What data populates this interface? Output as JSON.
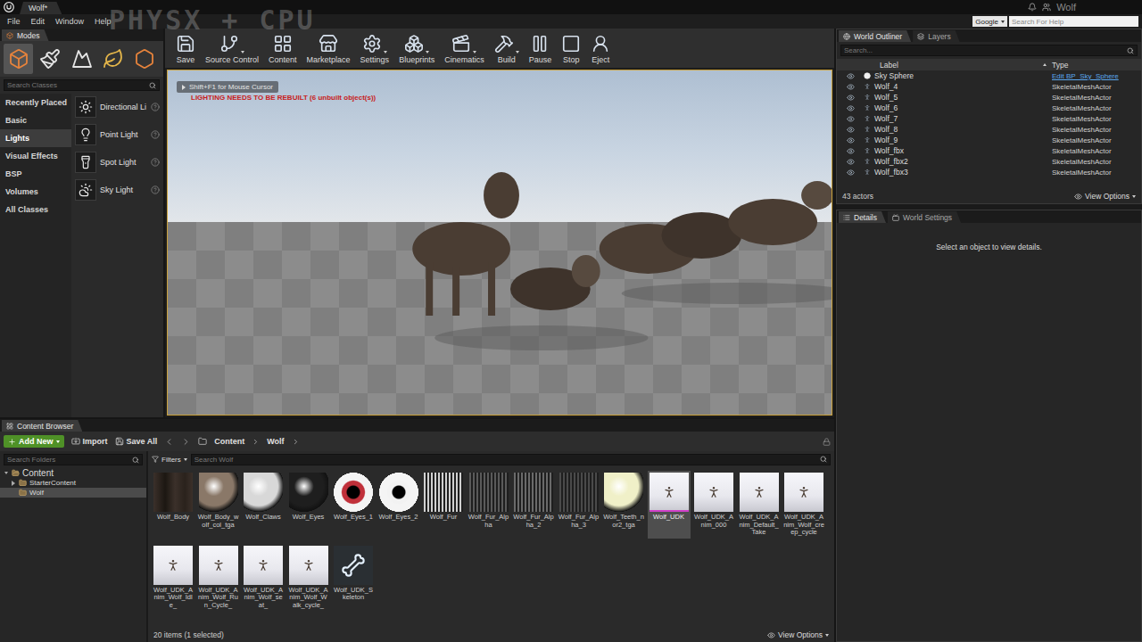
{
  "window": {
    "tab": "Wolf*",
    "title": "Wolf",
    "watermark": "PHYSX + CPU"
  },
  "menu": [
    "File",
    "Edit",
    "Window",
    "Help"
  ],
  "help_search": {
    "engine": "Google",
    "placeholder": "Search For Help"
  },
  "modes": {
    "tab": "Modes",
    "tools": [
      {
        "selected": true
      },
      {
        "selected": false
      },
      {
        "selected": false
      },
      {
        "selected": false
      },
      {
        "selected": false
      }
    ],
    "search_placeholder": "Search Classes",
    "categories": [
      {
        "label": "Recently Placed",
        "selected": false
      },
      {
        "label": "Basic",
        "selected": false
      },
      {
        "label": "Lights",
        "selected": true
      },
      {
        "label": "Visual Effects",
        "selected": false
      },
      {
        "label": "BSP",
        "selected": false
      },
      {
        "label": "Volumes",
        "selected": false
      },
      {
        "label": "All Classes",
        "selected": false
      }
    ],
    "items": [
      {
        "label": "Directional Li"
      },
      {
        "label": "Point Light"
      },
      {
        "label": "Spot Light"
      },
      {
        "label": "Sky Light"
      }
    ]
  },
  "toolbar": [
    {
      "label": "Save",
      "dropdown": false
    },
    {
      "label": "Source Control",
      "dropdown": true
    },
    {
      "label": "Content",
      "dropdown": false
    },
    {
      "label": "Marketplace",
      "dropdown": false
    },
    {
      "label": "Settings",
      "dropdown": true
    },
    {
      "label": "Blueprints",
      "dropdown": true
    },
    {
      "label": "Cinematics",
      "dropdown": true
    },
    {
      "label": "Build",
      "dropdown": true
    },
    {
      "label": "Pause",
      "dropdown": false
    },
    {
      "label": "Stop",
      "dropdown": false
    },
    {
      "label": "Eject",
      "dropdown": false
    }
  ],
  "viewport": {
    "hint": "Shift+F1 for Mouse Cursor",
    "warning": "LIGHTING NEEDS TO BE REBUILT (6 unbuilt object(s))"
  },
  "outliner": {
    "tabs": [
      {
        "label": "World Outliner",
        "selected": true
      },
      {
        "label": "Layers",
        "selected": false
      }
    ],
    "search_placeholder": "Search...",
    "columns": [
      "Label",
      "Type"
    ],
    "rows": [
      {
        "label": "Sky Sphere",
        "type": "Edit BP_Sky_Sphere",
        "link": true,
        "kind": "blueprint"
      },
      {
        "label": "Wolf_4",
        "type": "SkeletalMeshActor",
        "link": false,
        "kind": "skeletal"
      },
      {
        "label": "Wolf_5",
        "type": "SkeletalMeshActor",
        "link": false,
        "kind": "skeletal"
      },
      {
        "label": "Wolf_6",
        "type": "SkeletalMeshActor",
        "link": false,
        "kind": "skeletal"
      },
      {
        "label": "Wolf_7",
        "type": "SkeletalMeshActor",
        "link": false,
        "kind": "skeletal"
      },
      {
        "label": "Wolf_8",
        "type": "SkeletalMeshActor",
        "link": false,
        "kind": "skeletal"
      },
      {
        "label": "Wolf_9",
        "type": "SkeletalMeshActor",
        "link": false,
        "kind": "skeletal"
      },
      {
        "label": "Wolf_fbx",
        "type": "SkeletalMeshActor",
        "link": false,
        "kind": "skeletal"
      },
      {
        "label": "Wolf_fbx2",
        "type": "SkeletalMeshActor",
        "link": false,
        "kind": "skeletal"
      },
      {
        "label": "Wolf_fbx3",
        "type": "SkeletalMeshActor",
        "link": false,
        "kind": "skeletal"
      }
    ],
    "count": "43 actors",
    "view_options": "View Options"
  },
  "details": {
    "tabs": [
      {
        "label": "Details",
        "selected": true
      },
      {
        "label": "World Settings",
        "selected": false
      }
    ],
    "empty": "Select an object to view details."
  },
  "content_browser": {
    "tab": "Content Browser",
    "add_new": "Add New",
    "import": "Import",
    "save_all": "Save All",
    "path": [
      "Content",
      "Wolf"
    ],
    "folder_search": "Search Folders",
    "folders": [
      {
        "label": "Content",
        "expanded": true,
        "expandable": true,
        "selected": false,
        "children": [
          {
            "label": "StarterContent",
            "expanded": false,
            "expandable": true,
            "selected": false,
            "children": []
          },
          {
            "label": "Wolf",
            "expanded": false,
            "expandable": false,
            "selected": true,
            "children": []
          }
        ]
      }
    ],
    "filters": "Filters",
    "search_placeholder": "Search Wolf",
    "assets": [
      {
        "name": "Wolf_Body",
        "kind": "texture",
        "color": "#3b302a",
        "selected": false
      },
      {
        "name": "Wolf_Body_wolf_col_tga",
        "kind": "material",
        "color": "#8a7868",
        "selected": false
      },
      {
        "name": "Wolf_Claws",
        "kind": "material",
        "color": "#d8d8d8",
        "selected": false
      },
      {
        "name": "Wolf_Eyes",
        "kind": "material",
        "color": "#1e1e1e",
        "selected": false
      },
      {
        "name": "Wolf_Eyes_1",
        "kind": "eye",
        "color": "#c0303a",
        "selected": false
      },
      {
        "name": "Wolf_Eyes_2",
        "kind": "eye",
        "color": "#f2f2f2",
        "selected": false
      },
      {
        "name": "Wolf_Fur",
        "kind": "fur",
        "color": "#d0d0d0",
        "selected": false
      },
      {
        "name": "Wolf_Fur_Alpha",
        "kind": "fur",
        "color": "#5a5a5a",
        "selected": false
      },
      {
        "name": "Wolf_Fur_Alpha_2",
        "kind": "fur",
        "color": "#6a6a6a",
        "selected": false
      },
      {
        "name": "Wolf_Fur_Alpha_3",
        "kind": "fur",
        "color": "#4a4a4a",
        "selected": false
      },
      {
        "name": "Wolf_Teeth_nor2_tga",
        "kind": "material",
        "color": "#f0f0c8",
        "selected": false
      },
      {
        "name": "Wolf_UDK",
        "kind": "mesh",
        "color": "#e8e8ee",
        "selected": true
      },
      {
        "name": "Wolf_UDK_Anim_000",
        "kind": "mesh",
        "color": "#e8e8ee",
        "selected": false
      },
      {
        "name": "Wolf_UDK_Anim_Default_Take",
        "kind": "mesh",
        "color": "#e8e8ee",
        "selected": false
      },
      {
        "name": "Wolf_UDK_Anim_Wolf_creep_cycle",
        "kind": "mesh",
        "color": "#e8e8ee",
        "selected": false
      },
      {
        "name": "Wolf_UDK_Anim_Wolf_Idle_",
        "kind": "mesh",
        "color": "#e8e8ee",
        "selected": false
      },
      {
        "name": "Wolf_UDK_Anim_Wolf_Run_Cycle_",
        "kind": "mesh",
        "color": "#e8e8ee",
        "selected": false
      },
      {
        "name": "Wolf_UDK_Anim_Wolf_seat_",
        "kind": "mesh",
        "color": "#e8e8ee",
        "selected": false
      },
      {
        "name": "Wolf_UDK_Anim_Wolf_Walk_cycle_",
        "kind": "mesh",
        "color": "#e8e8ee",
        "selected": false
      },
      {
        "name": "Wolf_UDK_Skeleton",
        "kind": "skeleton",
        "color": "#2a2f33",
        "selected": false
      }
    ],
    "status": "20 items (1 selected)",
    "view_options": "View Options"
  }
}
